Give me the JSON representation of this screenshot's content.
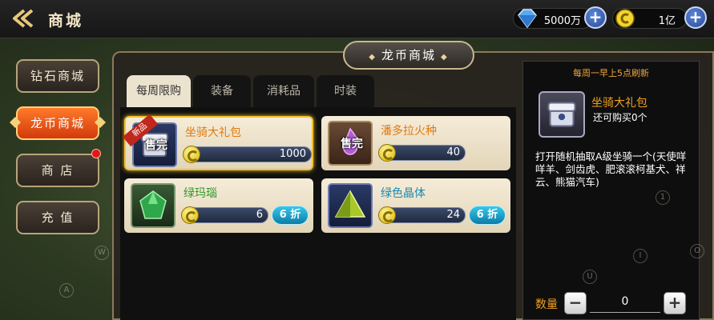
{
  "header": {
    "title": "商城",
    "currencies": [
      {
        "name": "diamond",
        "icon": "diamond-icon",
        "amount": "5000万"
      },
      {
        "name": "dragon-coin",
        "icon": "coin-icon",
        "amount": "1亿"
      }
    ]
  },
  "sidebar": {
    "items": [
      {
        "label": "钻石商城",
        "active": false
      },
      {
        "label": "龙币商城",
        "active": true
      },
      {
        "label": "商 店",
        "active": false,
        "badge": true
      },
      {
        "label": "充 值",
        "active": false
      }
    ]
  },
  "panel": {
    "title": "龙币商城",
    "tabs": [
      {
        "label": "每周限购",
        "active": true
      },
      {
        "label": "装备",
        "active": false
      },
      {
        "label": "消耗品",
        "active": false
      },
      {
        "label": "时装",
        "active": false
      }
    ]
  },
  "items": [
    {
      "name": "坐骑大礼包",
      "price": "1000",
      "status": "售完",
      "ribbon": "新品",
      "selected": true,
      "icon": "mount-chest-icon"
    },
    {
      "name": "潘多拉火种",
      "price": "40",
      "status": "售完",
      "icon": "pandora-fire-icon"
    },
    {
      "name": "绿玛瑙",
      "price": "6",
      "discount": "6 折",
      "icon": "green-agate-icon"
    },
    {
      "name": "绿色晶体",
      "price": "24",
      "discount": "6 折",
      "icon": "green-crystal-icon"
    }
  ],
  "detail": {
    "refresh_text": "每周一早上5点刷新",
    "name": "坐骑大礼包",
    "remaining": "还可购买0个",
    "description": "打开随机抽取A级坐骑一个(天使咩咩羊、剑齿虎、肥滚滚柯基犬、祥云、熊猫汽车)",
    "quantity_label": "数量",
    "quantity": "0",
    "minus_label": "−",
    "plus_label": "+"
  },
  "colors": {
    "accent_orange": "#e8581a",
    "gold_border": "#f2c12c",
    "discount_blue": "#1ea6d0",
    "item_name_orange": "#e07a10",
    "item_name_green": "#2e9a2a"
  }
}
